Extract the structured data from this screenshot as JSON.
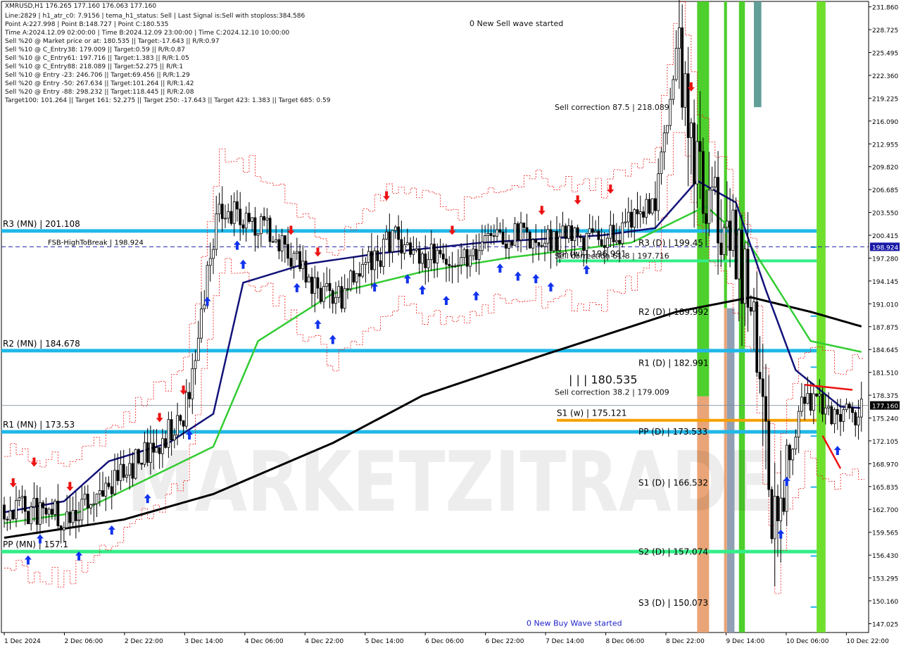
{
  "window": {
    "symbol_line": "XMRUSD,H1  176.265 177.160 176.063 177.160"
  },
  "info_lines": [
    "Line:2829  |  h1_atr_c0: 7.9156  |  tema_h1_status: Sell  |  Last Signal is:Sell with stoploss:384.586",
    "Point A:227.998  |  Point B:148.727  |  Point C:180.535",
    "Time A:2024.12.09 02:00:00  |  Time B:2024.12.09 23:00:00  |  Time C:2024.12.10 10:00:00",
    "Sell %20 @ Market price or at: 180.535  ||  Target:-17.643  ||  R/R:0.97",
    "Sell %10 @ C_Entry38: 179.009  ||  Target:0.59  ||  R/R:0.87",
    "Sell %10 @ C_Entry61: 197.716  ||  Target:1.383  ||  R/R:1.05",
    "Sell %10 @ C_Entry88: 218.089  ||  Target:52.275  ||  R/R:1",
    "Sell %10 @ Entry -23: 246.706  ||  Target:69.456  ||  R/R:1.29",
    "Sell %20 @ Entry -50: 267.634  ||  Target:101.264  ||  R/R:1.42",
    "Sell %20 @ Entry -88: 298.232  ||  Target:118.445  ||  R/R:2.08",
    "Target100: 101.264  ||  Target 161: 52.275  ||  Target 250: -17.643  ||  Target 423: 1.383  ||  Target 685: 0.59"
  ],
  "watermark": "MARKETZITRADE",
  "colors": {
    "background": "#ffffff",
    "bull": "#000000",
    "bear": "#000000",
    "level_blue": "#1fb8e8",
    "level_green": "#33ee88",
    "ema_navy": "#12127a",
    "ema_green": "#33cc33",
    "ema_black": "#000000",
    "zone_green": "#44cc22",
    "zone_lime": "#66dd22",
    "zone_orange": "#e8a070",
    "zone_teal": "#5a9a94",
    "zone_gray": "#8a9ab0",
    "signal_red": "#ee1111",
    "signal_blue": "#1133ee"
  },
  "chart_data": {
    "type": "candlestick",
    "title": "XMRUSD,H1",
    "ylim": [
      146.0,
      232.6
    ],
    "y_ticks": [
      "231.860",
      "228.725",
      "225.495",
      "222.360",
      "219.225",
      "216.090",
      "212.955",
      "209.820",
      "206.685",
      "203.550",
      "200.415",
      "197.280",
      "194.145",
      "191.010",
      "187.875",
      "184.645",
      "181.510",
      "178.375",
      "175.240",
      "172.105",
      "168.970",
      "165.835",
      "162.700",
      "159.565",
      "156.430",
      "153.295",
      "150.160",
      "147.025"
    ],
    "x_ticks": [
      "1 Dec 2024",
      "2 Dec 06:00",
      "2 Dec 22:00",
      "3 Dec 14:00",
      "4 Dec 06:00",
      "4 Dec 22:00",
      "5 Dec 14:00",
      "6 Dec 06:00",
      "6 Dec 22:00",
      "7 Dec 14:00",
      "8 Dec 06:00",
      "8 Dec 22:00",
      "9 Dec 14:00",
      "10 Dec 06:00",
      "10 Dec 22:00"
    ],
    "current_price": "177.160",
    "fsb_price": "198.924",
    "fsb_label": "FSB-HighToBreak  |  198.924",
    "levels": [
      {
        "label": "R3 (MN)  |  201.108",
        "value": 201.108,
        "color": "blue",
        "side": "left"
      },
      {
        "label": "R2 (MN)  |  184.678",
        "value": 184.678,
        "color": "blue",
        "side": "left"
      },
      {
        "label": "R1 (MN)  |  173.53",
        "value": 173.53,
        "color": "blue",
        "side": "left"
      },
      {
        "label": "PP (MN)  |  157.1",
        "value": 157.1,
        "color": "green",
        "side": "left"
      }
    ],
    "daily_levels": [
      {
        "label": "R3 (D)  |  199.45",
        "value": 199.45
      },
      {
        "label": "R2 (D)  |  189.992",
        "value": 189.992
      },
      {
        "label": "R1 (D)  |  182.991",
        "value": 182.991
      },
      {
        "label": "PP (D)  |  173.533",
        "value": 173.533
      },
      {
        "label": "S1 (D)  |  166.532",
        "value": 166.532
      },
      {
        "label": "S2 (D)  |  157.074",
        "value": 157.074
      },
      {
        "label": "S3 (D)  |  150.073",
        "value": 150.073
      }
    ],
    "weekly": {
      "pp_label": "PP (w)  |  196.991",
      "pp_value": 196.991,
      "s1_label": "S1 (w)  |  175.121",
      "s1_value": 175.121
    },
    "annotations": [
      {
        "text": "0 New Sell wave started",
        "value": 229.6
      },
      {
        "text": "Sell correction 87.5  |  218.089",
        "value": 218.089
      },
      {
        "text": "Sell correction 61.8  |  197.716",
        "value": 197.716
      },
      {
        "text": "Sell correction 38.2  |  179.009",
        "value": 179.009
      },
      {
        "text": "|  |  |  180.535",
        "value": 180.535
      },
      {
        "text": "0 New Buy Wave started",
        "value": 147.3
      }
    ],
    "anchor_points": [
      {
        "x": 0,
        "y": 163.5
      },
      {
        "x": 20,
        "y": 161.8
      },
      {
        "x": 40,
        "y": 168.0
      },
      {
        "x": 60,
        "y": 175.0
      },
      {
        "x": 72,
        "y": 205.0
      },
      {
        "x": 90,
        "y": 200.5
      },
      {
        "x": 110,
        "y": 191.0
      },
      {
        "x": 130,
        "y": 200.0
      },
      {
        "x": 150,
        "y": 196.0
      },
      {
        "x": 170,
        "y": 201.0
      },
      {
        "x": 200,
        "y": 199.5
      },
      {
        "x": 218,
        "y": 205.0
      },
      {
        "x": 225,
        "y": 226.0
      },
      {
        "x": 232,
        "y": 210.0
      },
      {
        "x": 242,
        "y": 201.0
      },
      {
        "x": 250,
        "y": 192.0
      },
      {
        "x": 258,
        "y": 160.0
      },
      {
        "x": 262,
        "y": 170.0
      },
      {
        "x": 268,
        "y": 178.0
      },
      {
        "x": 280,
        "y": 175.0
      },
      {
        "x": 287,
        "y": 176.5
      }
    ],
    "ema_navy": [
      {
        "x": 0,
        "y": 162.5
      },
      {
        "x": 20,
        "y": 164.0
      },
      {
        "x": 35,
        "y": 169.5
      },
      {
        "x": 55,
        "y": 172.0
      },
      {
        "x": 70,
        "y": 176.0
      },
      {
        "x": 80,
        "y": 194.0
      },
      {
        "x": 100,
        "y": 196.5
      },
      {
        "x": 125,
        "y": 198.0
      },
      {
        "x": 160,
        "y": 199.5
      },
      {
        "x": 200,
        "y": 200.5
      },
      {
        "x": 218,
        "y": 201.5
      },
      {
        "x": 232,
        "y": 208.0
      },
      {
        "x": 245,
        "y": 205.0
      },
      {
        "x": 255,
        "y": 193.0
      },
      {
        "x": 265,
        "y": 182.0
      },
      {
        "x": 280,
        "y": 177.0
      },
      {
        "x": 287,
        "y": 176.8
      }
    ],
    "ema_green": [
      {
        "x": 0,
        "y": 161.0
      },
      {
        "x": 25,
        "y": 162.5
      },
      {
        "x": 45,
        "y": 166.5
      },
      {
        "x": 70,
        "y": 171.5
      },
      {
        "x": 85,
        "y": 186.0
      },
      {
        "x": 110,
        "y": 192.5
      },
      {
        "x": 140,
        "y": 195.5
      },
      {
        "x": 170,
        "y": 197.5
      },
      {
        "x": 210,
        "y": 199.5
      },
      {
        "x": 235,
        "y": 204.5
      },
      {
        "x": 250,
        "y": 199.0
      },
      {
        "x": 270,
        "y": 186.0
      },
      {
        "x": 287,
        "y": 184.5
      }
    ],
    "ema_black": [
      {
        "x": 0,
        "y": 159.0
      },
      {
        "x": 40,
        "y": 161.5
      },
      {
        "x": 70,
        "y": 165.0
      },
      {
        "x": 110,
        "y": 172.0
      },
      {
        "x": 140,
        "y": 178.5
      },
      {
        "x": 180,
        "y": 184.0
      },
      {
        "x": 225,
        "y": 190.0
      },
      {
        "x": 250,
        "y": 192.0
      },
      {
        "x": 270,
        "y": 190.0
      },
      {
        "x": 287,
        "y": 188.0
      }
    ]
  }
}
